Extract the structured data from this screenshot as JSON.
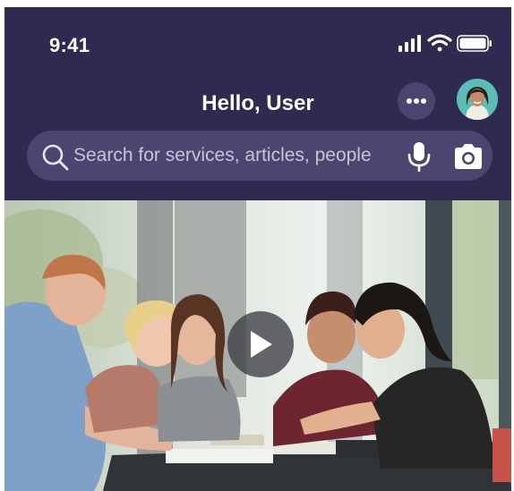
{
  "status_bar": {
    "time": "9:41",
    "icons": [
      "cellular-signal-icon",
      "wifi-icon",
      "battery-icon"
    ]
  },
  "header": {
    "greeting": "Hello, User",
    "background_color": "#2f2a4f",
    "more_icon": "more-horizontal-icon",
    "avatar_icon": "user-avatar"
  },
  "search": {
    "placeholder": "Search for services, articles, people",
    "value": "",
    "icons": [
      "search-icon",
      "microphone-icon",
      "camera-icon"
    ]
  },
  "media": {
    "type": "video",
    "play_icon": "play-icon"
  }
}
